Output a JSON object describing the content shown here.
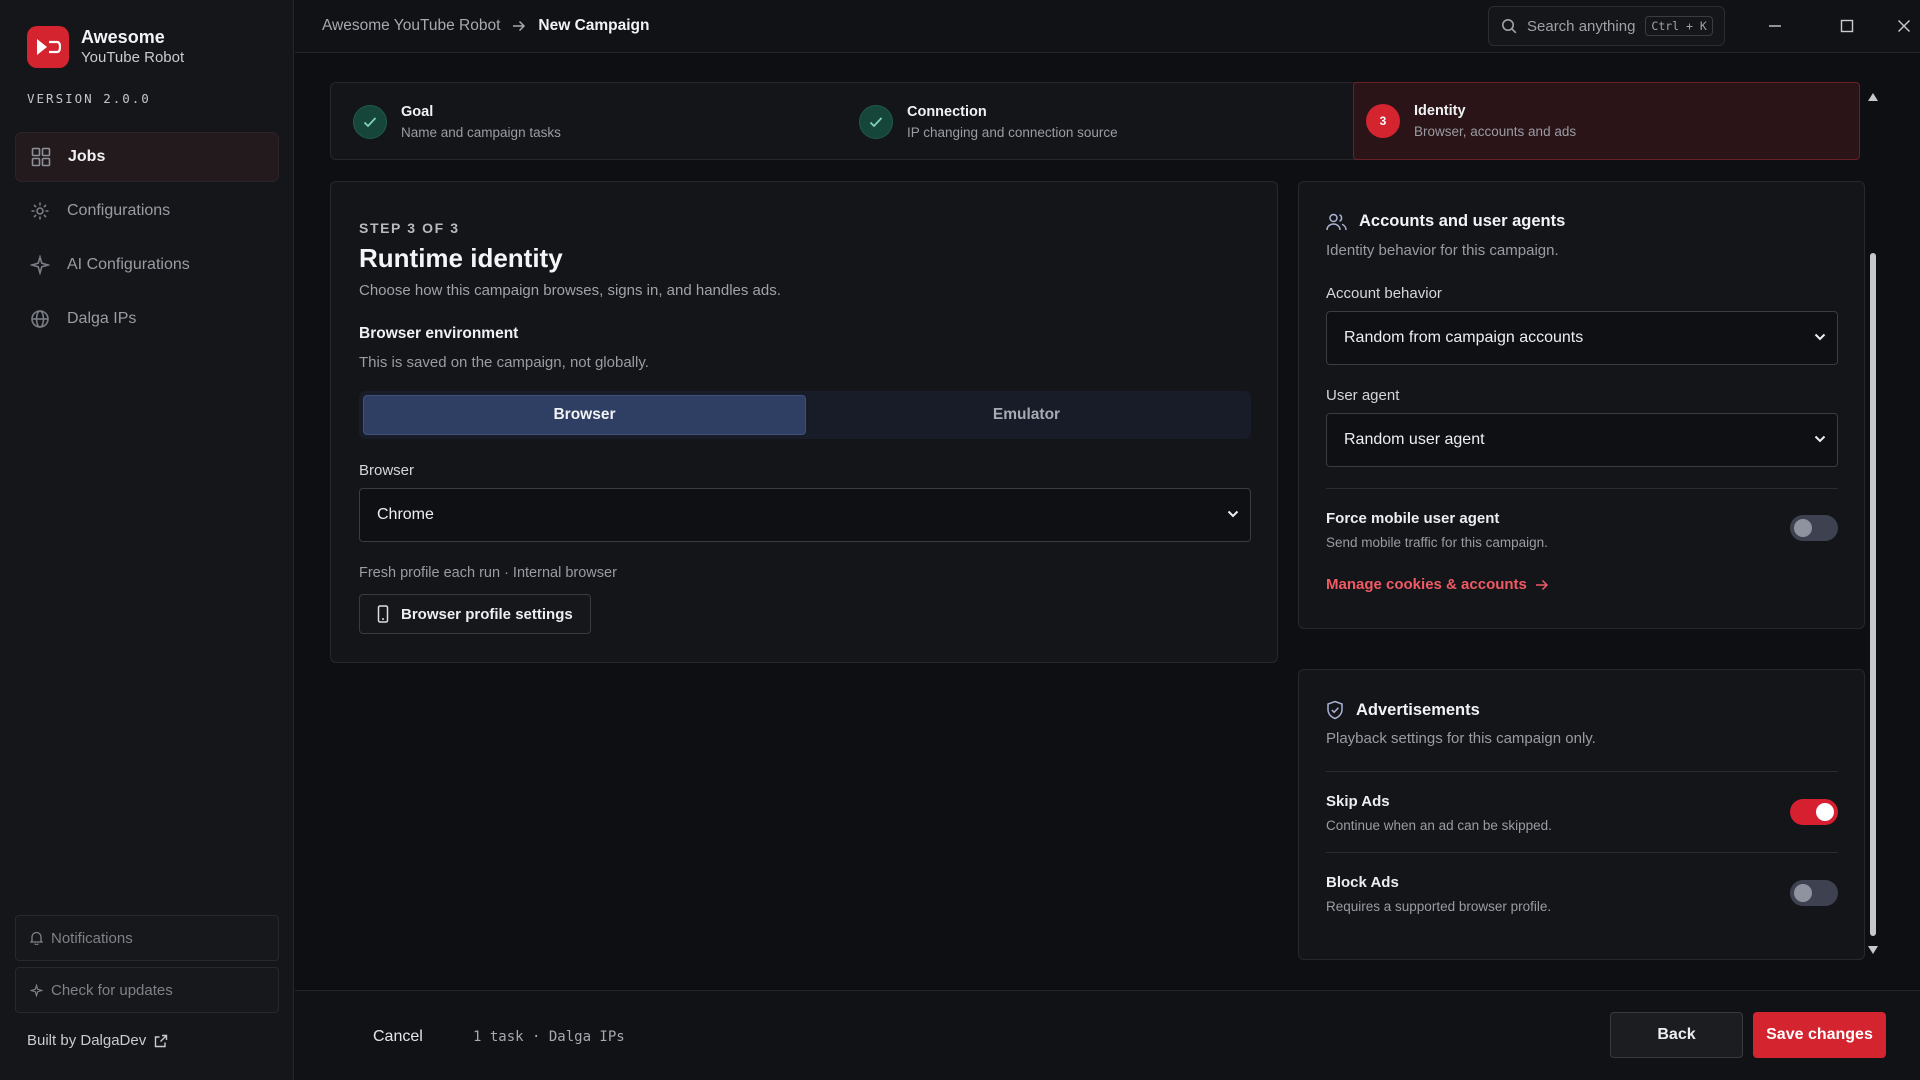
{
  "app": {
    "name": "Awesome",
    "subtitle": "YouTube Robot",
    "version": "VERSION 2.0.0"
  },
  "sidebar": {
    "items": [
      {
        "label": "Jobs",
        "icon": "grid-icon",
        "active": true
      },
      {
        "label": "Configurations",
        "icon": "gear-icon"
      },
      {
        "label": "AI Configurations",
        "icon": "sparkle-icon"
      },
      {
        "label": "Dalga IPs",
        "icon": "globe-icon"
      }
    ],
    "notifications": "Notifications",
    "updates": "Check for updates",
    "built_by": "Built by DalgaDev"
  },
  "header": {
    "breadcrumb_root": "Awesome YouTube Robot",
    "breadcrumb_current": "New Campaign",
    "search_placeholder": "Search anything",
    "search_shortcut": "Ctrl + K"
  },
  "steps": [
    {
      "title": "Goal",
      "desc": "Name and campaign tasks",
      "status": "done"
    },
    {
      "title": "Connection",
      "desc": "IP changing and connection source",
      "status": "done"
    },
    {
      "number": "3",
      "title": "Identity",
      "desc": "Browser, accounts and ads",
      "status": "current"
    }
  ],
  "main": {
    "eyebrow": "STEP 3 OF 3",
    "title": "Runtime identity",
    "lead": "Choose how this campaign browses, signs in, and handles ads.",
    "env_title": "Browser environment",
    "env_desc": "This is saved on the campaign, not globally.",
    "env_options": [
      "Browser",
      "Emulator"
    ],
    "browser_label": "Browser",
    "browser_value": "Chrome",
    "profile_note": "Fresh profile each run · Internal browser",
    "profile_button": "Browser profile settings"
  },
  "accounts": {
    "title": "Accounts and user agents",
    "desc": "Identity behavior for this campaign.",
    "behavior_label": "Account behavior",
    "behavior_value": "Random from campaign accounts",
    "ua_label": "User agent",
    "ua_value": "Random user agent",
    "force_mobile_title": "Force mobile user agent",
    "force_mobile_desc": "Send mobile traffic for this campaign.",
    "force_mobile_on": false,
    "manage_link": "Manage cookies & accounts"
  },
  "ads": {
    "title": "Advertisements",
    "desc": "Playback settings for this campaign only.",
    "skip_title": "Skip Ads",
    "skip_desc": "Continue when an ad can be skipped.",
    "skip_on": true,
    "block_title": "Block Ads",
    "block_desc": "Requires a supported browser profile.",
    "block_on": false
  },
  "footer": {
    "cancel": "Cancel",
    "summary": "1 task · Dalga IPs",
    "back": "Back",
    "save": "Save changes"
  },
  "colors": {
    "accent": "#d32430",
    "success": "#16463a",
    "segment_active": "#2e3f63"
  }
}
